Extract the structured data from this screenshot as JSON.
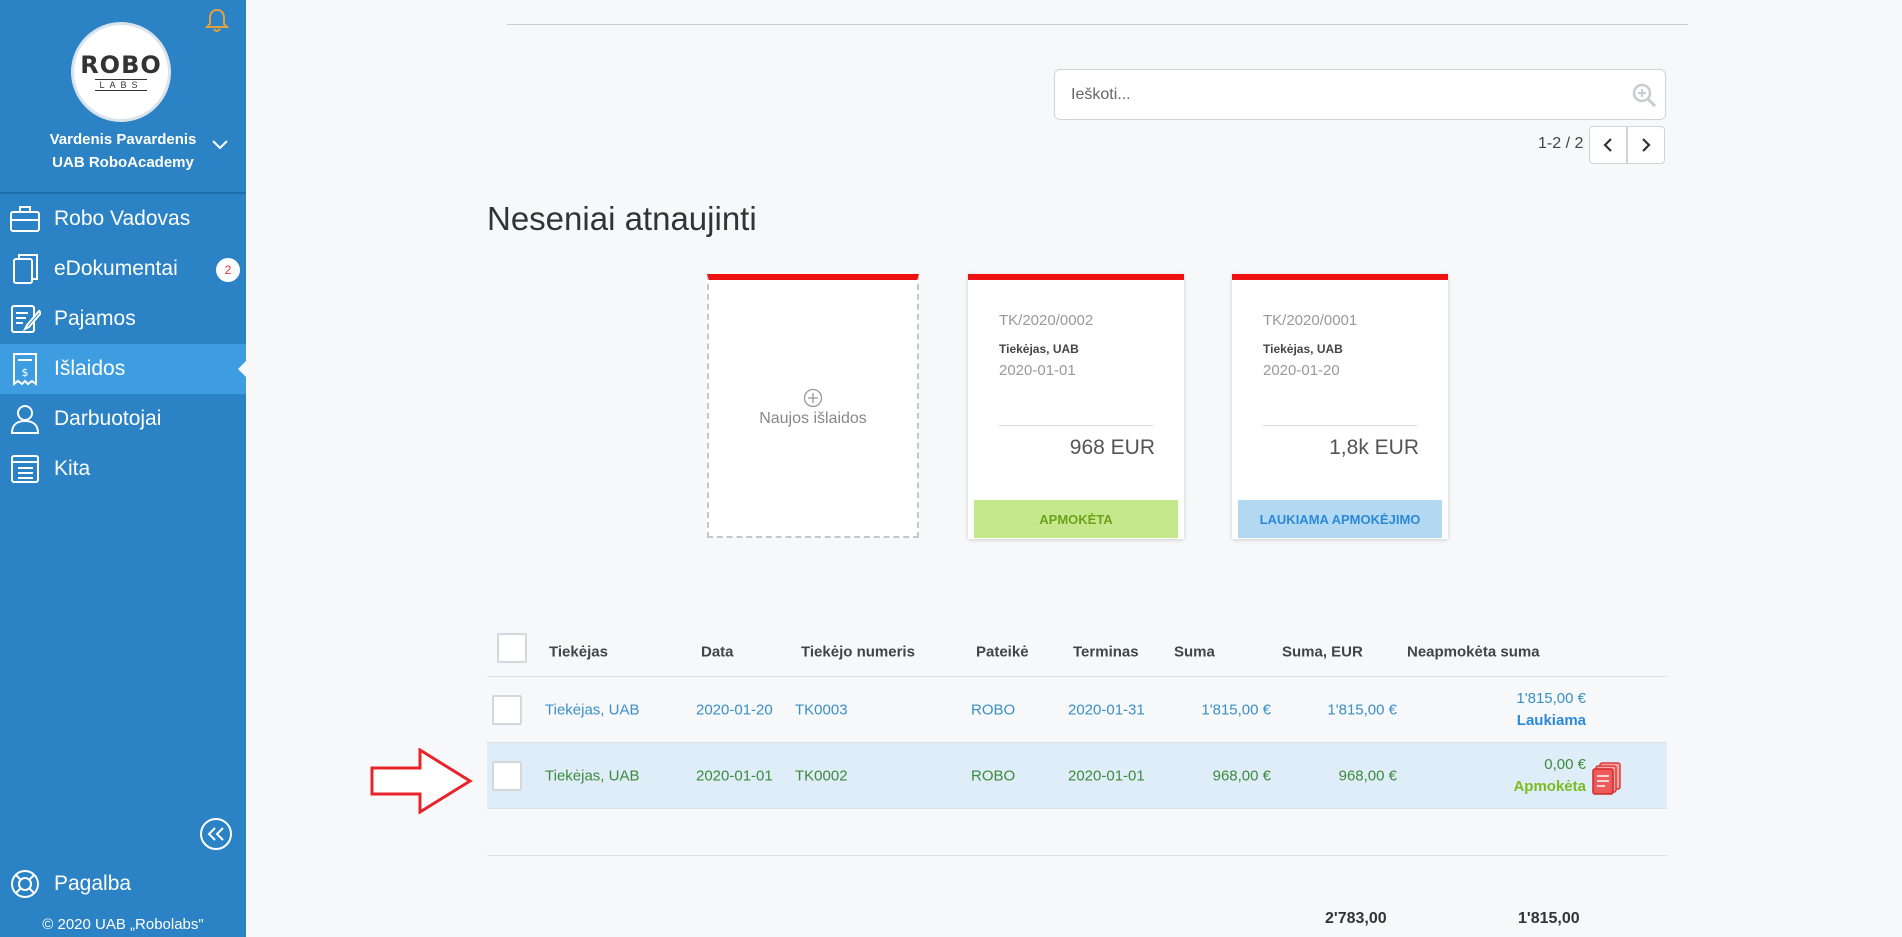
{
  "colors": {
    "sidebar": "#2b82c5",
    "sidebar_active": "#3e9ce0",
    "card_top": "#ee1111",
    "paid_bg": "#c6e88c",
    "pending_bg": "#b3d8f2",
    "annotation_arrow": "#e8242b"
  },
  "sidebar": {
    "logo": {
      "top": "ROBO",
      "bottom": "LABS"
    },
    "user_name": "Vardenis Pavardenis",
    "company": "UAB RoboAcademy",
    "items": [
      {
        "label": "Robo Vadovas",
        "icon": "briefcase-icon"
      },
      {
        "label": "eDokumentai",
        "icon": "documents-icon",
        "badge": "2"
      },
      {
        "label": "Pajamos",
        "icon": "edit-doc-icon"
      },
      {
        "label": "Išlaidos",
        "icon": "receipt-icon",
        "active": true
      },
      {
        "label": "Darbuotojai",
        "icon": "person-icon"
      },
      {
        "label": "Kita",
        "icon": "list-icon"
      }
    ],
    "help": "Pagalba",
    "copyright": "© 2020 UAB „Robolabs\""
  },
  "search": {
    "placeholder": "Ieškoti..."
  },
  "pager": {
    "text": "1-2 / 2"
  },
  "section_title": "Neseniai atnaujinti",
  "new_card_label": "Naujos išlaidos",
  "cards": [
    {
      "number": "TK/2020/0002",
      "supplier": "Tiekėjas, UAB",
      "date": "2020-01-01",
      "amount": "968 EUR",
      "status": "APMOKĖTA"
    },
    {
      "number": "TK/2020/0001",
      "supplier": "Tiekėjas, UAB",
      "date": "2020-01-20",
      "amount": "1,8k EUR",
      "status": "LAUKIAMA APMOKĖJIMO"
    }
  ],
  "table": {
    "headers": [
      "Tiekėjas",
      "Data",
      "Tiekėjo numeris",
      "Pateikė",
      "Terminas",
      "Suma",
      "Suma, EUR",
      "Neapmokėta suma"
    ],
    "rows": [
      {
        "supplier": "Tiekėjas, UAB",
        "date": "2020-01-20",
        "number": "TK0003",
        "submitted_by": "ROBO",
        "due": "2020-01-31",
        "sum": "1'815,00 €",
        "sum_eur": "1'815,00 €",
        "unpaid": "1'815,00 €",
        "status": "Laukiama"
      },
      {
        "supplier": "Tiekėjas, UAB",
        "date": "2020-01-01",
        "number": "TK0002",
        "submitted_by": "ROBO",
        "due": "2020-01-01",
        "sum": "968,00 €",
        "sum_eur": "968,00 €",
        "unpaid": "0,00 €",
        "status": "Apmokėta"
      }
    ],
    "totals": {
      "sum_eur": "2'783,00",
      "unpaid": "1'815,00"
    }
  }
}
